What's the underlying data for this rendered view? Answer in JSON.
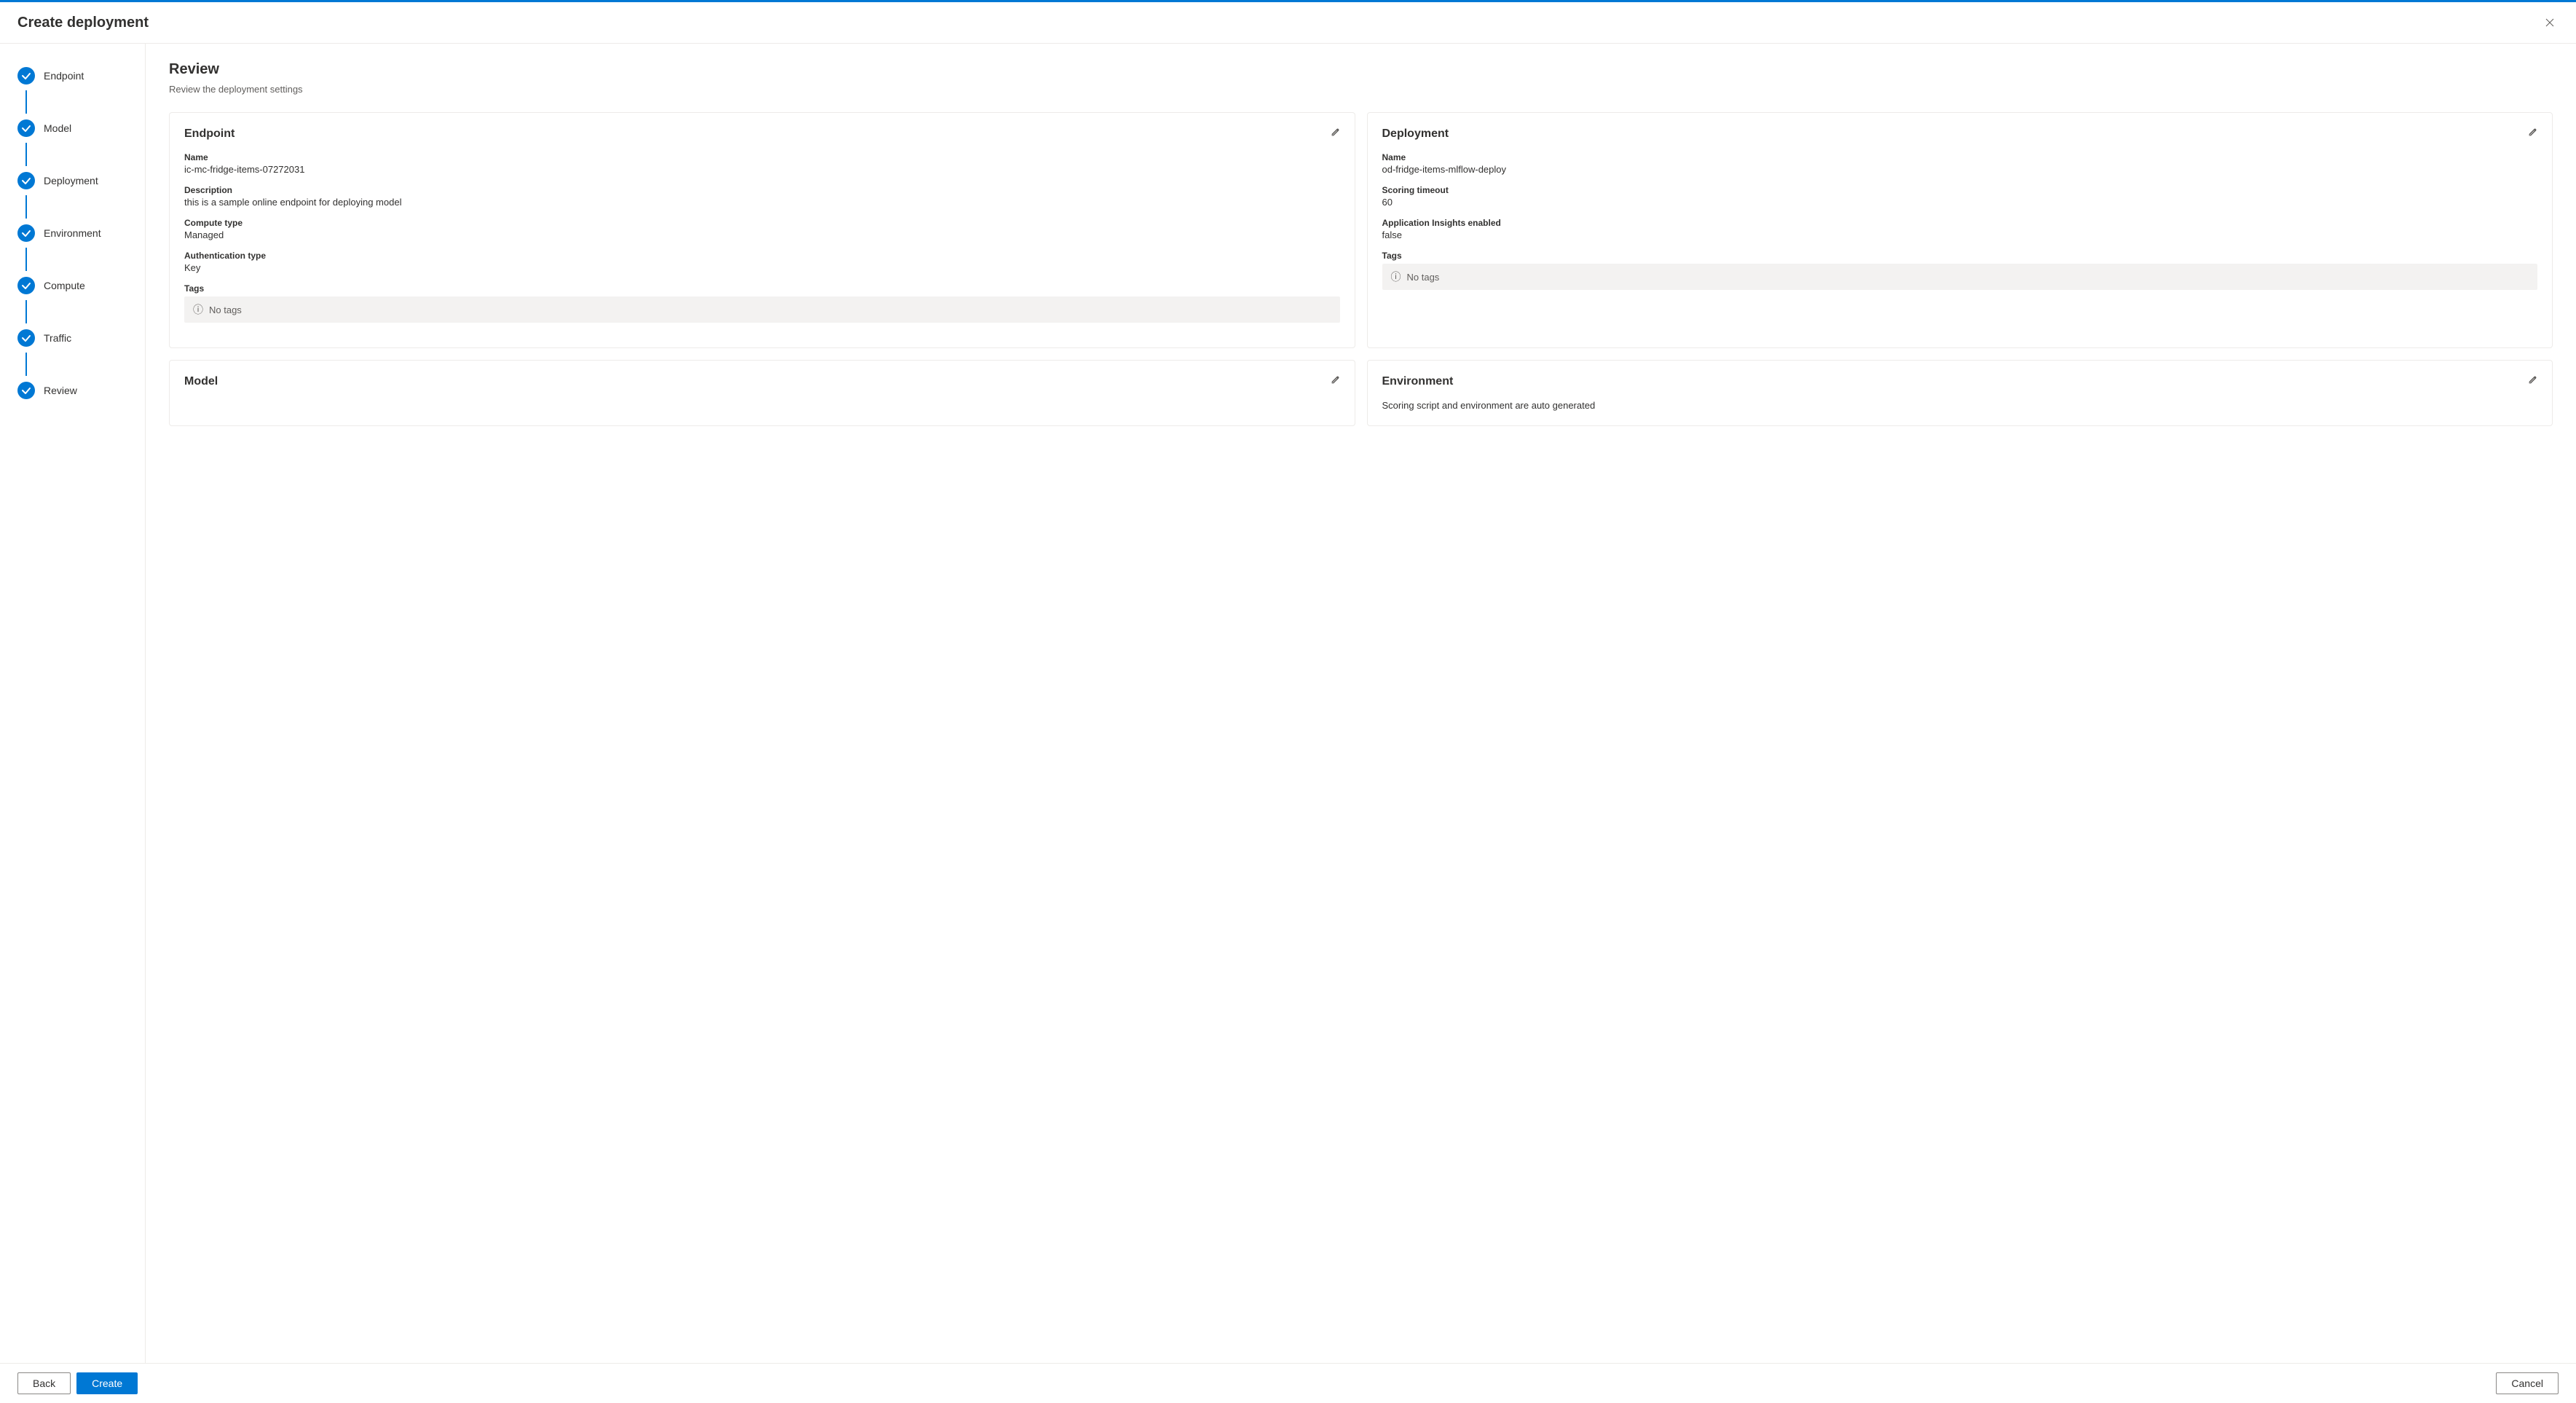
{
  "dialog": {
    "title": "Create deployment",
    "close_label": "×"
  },
  "sidebar": {
    "steps": [
      {
        "id": "endpoint",
        "label": "Endpoint",
        "completed": true
      },
      {
        "id": "model",
        "label": "Model",
        "completed": true
      },
      {
        "id": "deployment",
        "label": "Deployment",
        "completed": true
      },
      {
        "id": "environment",
        "label": "Environment",
        "completed": true
      },
      {
        "id": "compute",
        "label": "Compute",
        "completed": true
      },
      {
        "id": "traffic",
        "label": "Traffic",
        "completed": true
      },
      {
        "id": "review",
        "label": "Review",
        "completed": true
      }
    ]
  },
  "review": {
    "title": "Review",
    "subtitle": "Review the deployment settings"
  },
  "endpoint_card": {
    "title": "Endpoint",
    "fields": [
      {
        "label": "Name",
        "value": "ic-mc-fridge-items-07272031"
      },
      {
        "label": "Description",
        "value": "this is a sample online endpoint for deploying model"
      },
      {
        "label": "Compute type",
        "value": "Managed"
      },
      {
        "label": "Authentication type",
        "value": "Key"
      }
    ],
    "tags_label": "Tags",
    "no_tags": "No tags"
  },
  "deployment_card": {
    "title": "Deployment",
    "fields": [
      {
        "label": "Name",
        "value": "od-fridge-items-mlflow-deploy"
      },
      {
        "label": "Scoring timeout",
        "value": "60"
      },
      {
        "label": "Application Insights enabled",
        "value": "false"
      }
    ],
    "tags_label": "Tags",
    "no_tags": "No tags"
  },
  "model_card": {
    "title": "Model"
  },
  "environment_card": {
    "title": "Environment",
    "description": "Scoring script and environment are auto generated"
  },
  "footer": {
    "back_label": "Back",
    "create_label": "Create",
    "cancel_label": "Cancel"
  }
}
